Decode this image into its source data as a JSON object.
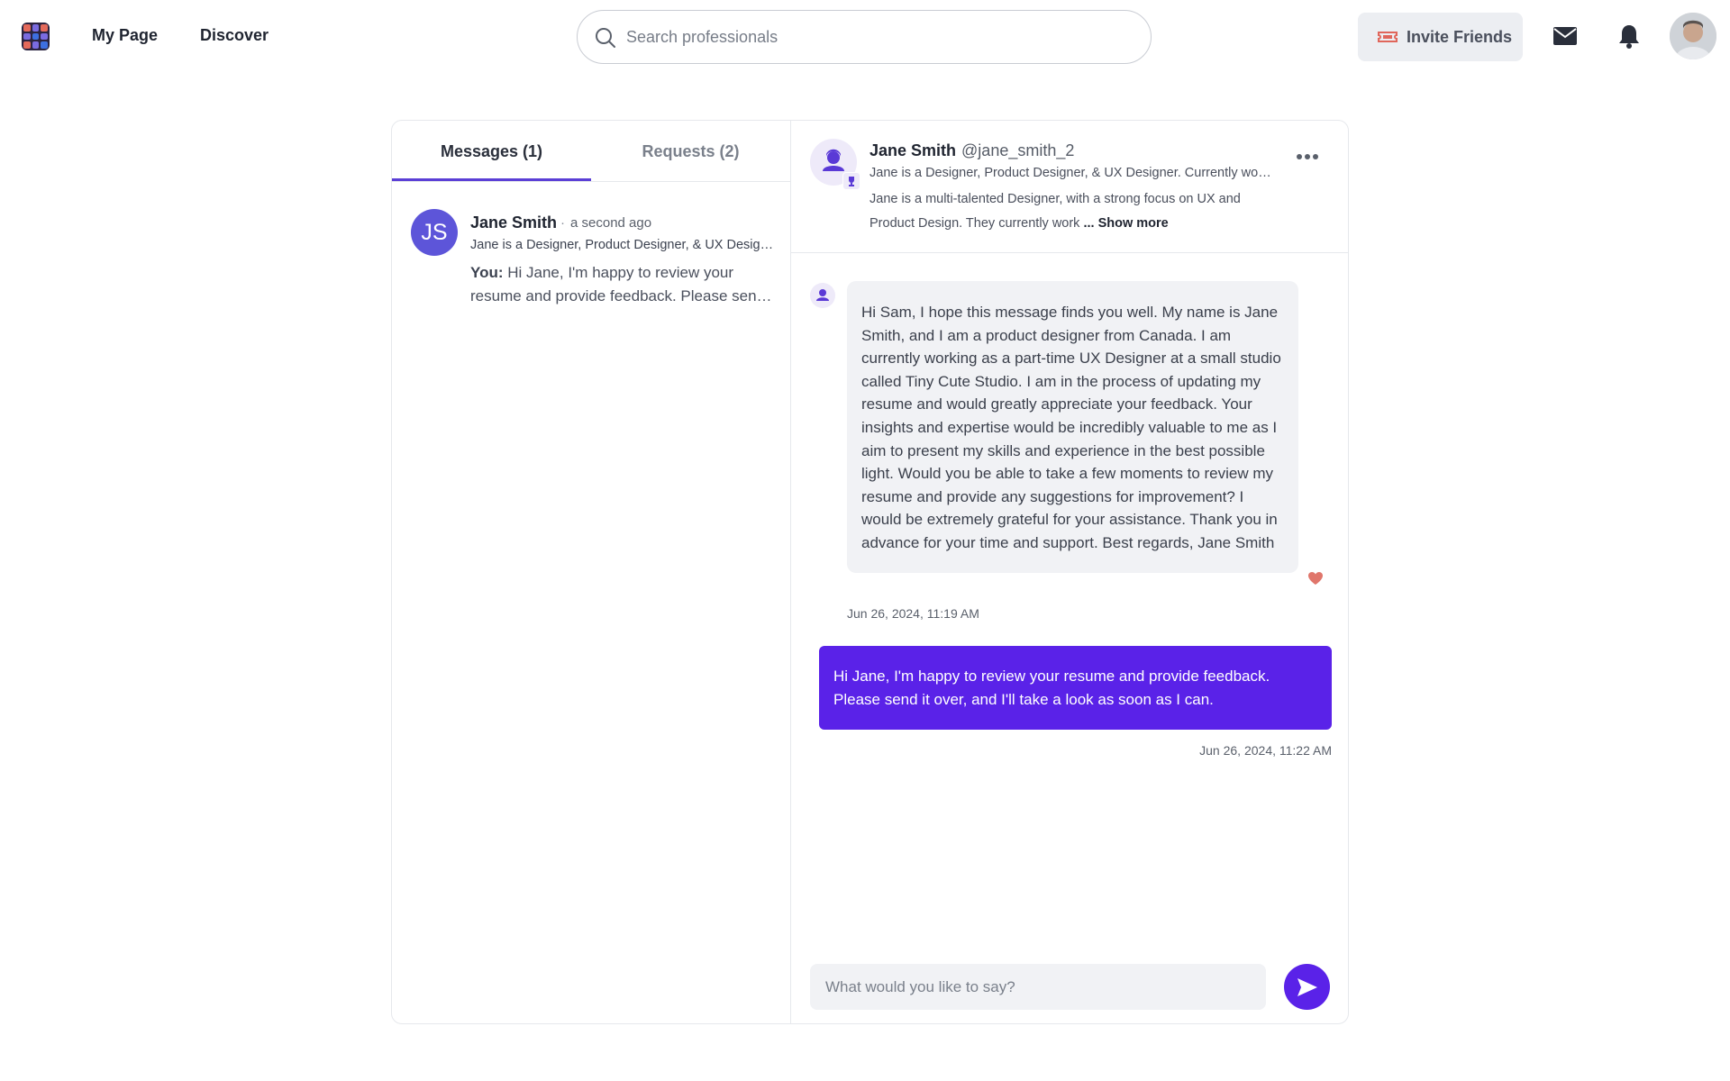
{
  "nav": {
    "my_page": "My Page",
    "discover": "Discover",
    "invite_label": "Invite Friends"
  },
  "search": {
    "placeholder": "Search professionals"
  },
  "icons": {
    "logo": "app-logo-grid",
    "search": "search-icon",
    "invite": "ticket-icon",
    "messages": "mail-icon",
    "notifications": "bell-icon",
    "more": "more-horizontal-icon",
    "like": "heart-icon",
    "send": "send-icon"
  },
  "colors": {
    "accent": "#5a22e8",
    "tab_underline": "#5b3fd6",
    "avatar_bg": "#5d55d9",
    "heart": "#e0766b"
  },
  "tabs": [
    {
      "label": "Messages  (1)",
      "active": true
    },
    {
      "label": "Requests  (2)",
      "active": false
    }
  ],
  "conversation": {
    "initials": "JS",
    "name": "Jane Smith",
    "time": "a second ago",
    "headline": "Jane is a Designer, Product Designer, & UX Designer. Currently working as a part-time UX Designer",
    "preview_prefix": "You:",
    "preview": "Hi Jane, I'm happy to review your resume and provide feedback. Please send it over, and I'll take a look as soon as I can."
  },
  "profile": {
    "name": "Jane Smith",
    "handle": "@jane_smith_2",
    "headline": "Jane is a Designer, Product Designer, & UX Designer. Currently working as a part-time UX Designer",
    "bio": "Jane is a multi-talented Designer, with a strong focus on UX and Product Design. They currently work",
    "show_more": "... Show more"
  },
  "messages": [
    {
      "direction": "incoming",
      "text": "Hi Sam, I hope this message finds you well. My name is Jane Smith, and I am a product designer from Canada. I am currently working as a part-time UX Designer at a small studio called Tiny Cute Studio. I am in the process of updating my resume and would greatly appreciate your feedback. Your insights and expertise would be incredibly valuable to me as I aim to present my skills and experience in the best possible light. Would you be able to take a few moments to review my resume and provide any suggestions for improvement? I would be extremely grateful for your assistance. Thank you in advance for your time and support. Best regards, Jane Smith",
      "timestamp": "Jun 26, 2024, 11:19 AM",
      "liked": true
    },
    {
      "direction": "outgoing",
      "text": "Hi Jane, I'm happy to review your resume and provide feedback. Please send it over, and I'll take a look as soon as I can.",
      "timestamp": "Jun 26, 2024, 11:22 AM"
    }
  ],
  "composer": {
    "placeholder": "What would you like to say?"
  }
}
